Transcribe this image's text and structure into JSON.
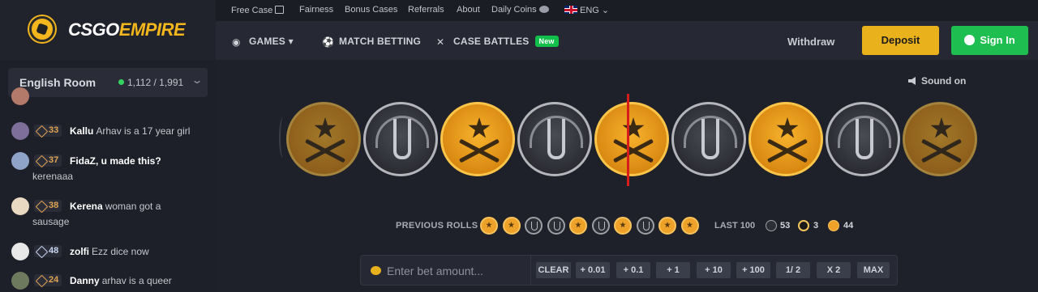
{
  "brand": {
    "left": "CSGO",
    "right": "EMPIRE"
  },
  "topnav": {
    "free_case": "Free Case",
    "fairness": "Fairness",
    "bonus_cases": "Bonus Cases",
    "referrals": "Referrals",
    "about": "About",
    "daily_coins": "Daily Coins",
    "language": "ENG"
  },
  "mainnav": {
    "games": "GAMES",
    "match_betting": "MATCH BETTING",
    "case_battles": "CASE BATTLES",
    "new_badge": "New",
    "withdraw": "Withdraw",
    "deposit": "Deposit",
    "sign_in": "Sign In"
  },
  "room": {
    "name": "English Room",
    "online": "1,112 / 1,991"
  },
  "chat": [
    {
      "level": "33",
      "user": "Kallu",
      "text": "Arhav is a 17 year girl",
      "cont": ""
    },
    {
      "level": "37",
      "user": "FidaZ, u made this?",
      "text": "",
      "cont": "kerenaaa"
    },
    {
      "level": "38",
      "user": "Kerena",
      "text": "woman got a",
      "cont": "sausage"
    },
    {
      "level": "48",
      "user": "zolfi",
      "text": "Ezz dice now",
      "cont": ""
    },
    {
      "level": "24",
      "user": "Danny",
      "text": "arhav is a queer",
      "cont": ""
    }
  ],
  "sound": "Sound on",
  "reel": [
    "t",
    "ct",
    "t",
    "ct",
    "t",
    "ct",
    "t",
    "ct",
    "t"
  ],
  "previous_rolls": {
    "label": "PREVIOUS ROLLS",
    "rolls": [
      "t",
      "t",
      "ct",
      "ct",
      "t",
      "ct",
      "t",
      "ct",
      "t",
      "t"
    ]
  },
  "last100": {
    "label": "LAST 100",
    "ct": "53",
    "bonus": "3",
    "t": "44"
  },
  "bet": {
    "placeholder": "Enter bet amount...",
    "buttons": [
      "CLEAR",
      "+ 0.01",
      "+ 0.1",
      "+ 1",
      "+ 10",
      "+ 100",
      "1/ 2",
      "X 2",
      "MAX"
    ]
  },
  "colors": {
    "accent_yellow": "#e9b21c",
    "accent_green": "#1fbe50",
    "indicator_red": "#d81b1b"
  }
}
